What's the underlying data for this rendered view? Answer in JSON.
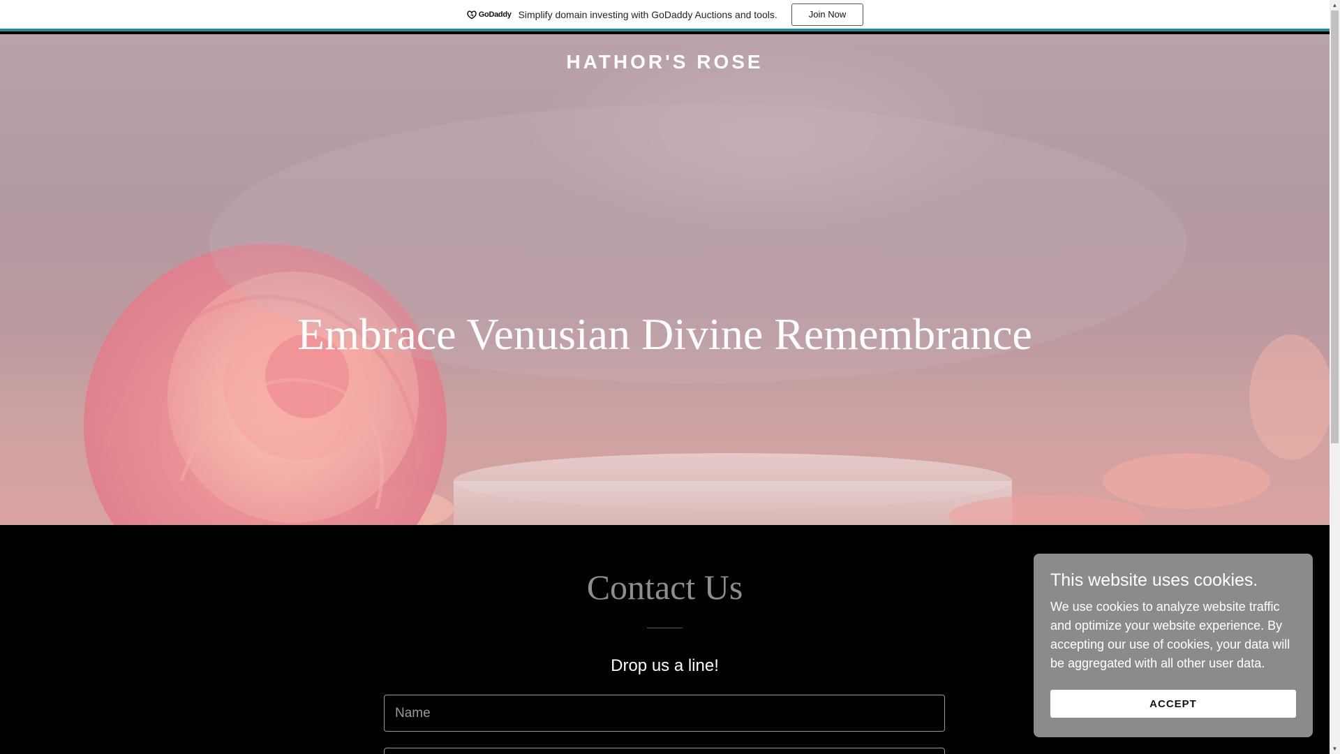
{
  "promo": {
    "logo_text": "GoDaddy",
    "message": "Simplify domain investing with GoDaddy Auctions and tools.",
    "button_label": "Join Now",
    "accent_color": "#1f8f96"
  },
  "hero": {
    "site_title": "HATHOR'S ROSE",
    "heading": "Embrace Venusian Divine Remembrance"
  },
  "contact": {
    "title": "Contact Us",
    "subtitle": "Drop us a line!",
    "name_placeholder": "Name",
    "email_placeholder": ""
  },
  "cookie_banner": {
    "title": "This website uses cookies.",
    "text": "We use cookies to analyze website traffic and optimize your website experience. By accepting our use of cookies, your data will be aggregated with all other user data.",
    "accept_label": "ACCEPT"
  },
  "scrollbar": {
    "up_icon": "chevron-up-icon",
    "down_icon": "chevron-down-icon"
  }
}
